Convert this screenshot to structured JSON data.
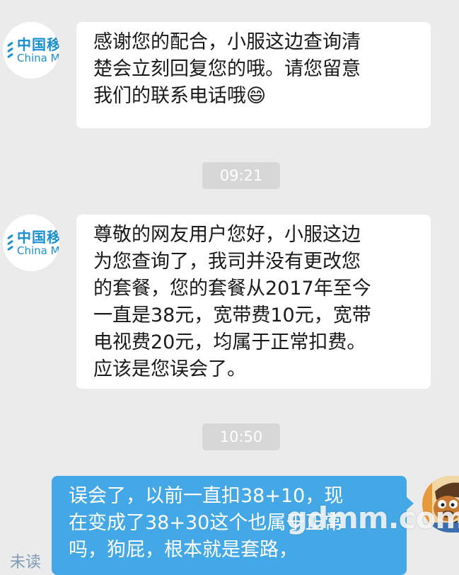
{
  "messages": [
    {
      "side": "left",
      "sender_logo": {
        "cn": "中国移",
        "en": "China M"
      },
      "lines": [
        "感谢您的配合，小服这边查询清",
        "楚会立刻回复您的哦。请您留意",
        "我们的联系电话哦😄"
      ]
    },
    {
      "timestamp": "09:21"
    },
    {
      "side": "left",
      "sender_logo": {
        "cn": "中国移",
        "en": "China M"
      },
      "lines": [
        "尊敬的网友用户您好，小服这边",
        "为您查询了，我司并没有更改您",
        "的套餐，您的套餐从2017年至今",
        "一直是38元，宽带费10元，宽带",
        "电视费20元，均属于正常扣费。",
        "应该是您误会了。"
      ]
    },
    {
      "timestamp": "10:50"
    },
    {
      "side": "right",
      "lines": [
        "误会了，以前一直扣38+10，现",
        "在变成了38+30这个也属于正常",
        "吗，狗屁，根本就是套路，"
      ]
    }
  ],
  "status": {
    "unread_label": "未读"
  },
  "watermark": "gdmm.com",
  "colors": {
    "background": "#ebebeb",
    "bubble_left": "#ffffff",
    "bubble_right": "#45a8e6",
    "brand": "#1a8fd0"
  }
}
